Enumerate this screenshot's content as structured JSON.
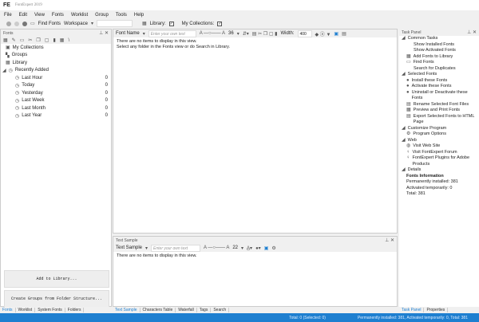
{
  "app": {
    "logo": "FE",
    "title": "FontExpert 2019"
  },
  "menu": [
    "File",
    "Edit",
    "View",
    "Fonts",
    "Worklist",
    "Group",
    "Tools",
    "Help"
  ],
  "toolbar": {
    "find_fonts": "Find Fonts",
    "workspace": "Workspace",
    "library": "Library:",
    "my_collections": "My Collections:"
  },
  "fonts_panel": {
    "title": "Fonts",
    "tree": [
      {
        "label": "My Collections"
      },
      {
        "label": "Groups"
      },
      {
        "label": "Library"
      },
      {
        "label": "Recently Added"
      }
    ],
    "recent": [
      {
        "label": "Last Hour",
        "count": "0"
      },
      {
        "label": "Today",
        "count": "0"
      },
      {
        "label": "Yesterday",
        "count": "0"
      },
      {
        "label": "Last Week",
        "count": "0"
      },
      {
        "label": "Last Month",
        "count": "0"
      },
      {
        "label": "Last Year",
        "count": "0"
      }
    ],
    "add_button": "Add to Library...",
    "create_groups_button": "Create Groups from Folder Structure...",
    "tabs": [
      "Fonts",
      "Worklist",
      "System Fonts",
      "Folders"
    ]
  },
  "font_view": {
    "mode": "Font Name",
    "placeholder": "Enter your own text",
    "size": "36",
    "width_label": "Width:",
    "width": "400",
    "empty1": "There are no items to display in this view.",
    "empty2": "Select any folder in the Fonts view or do Search in Library."
  },
  "text_sample": {
    "title": "Text Sample",
    "mode": "Text Sample",
    "placeholder": "Enter your own text",
    "size": "22",
    "empty": "There are no items to display in this view.",
    "tabs": [
      "Text Sample",
      "Characters Table",
      "Waterfall",
      "Tags",
      "Search"
    ]
  },
  "task_panel": {
    "title": "Task Panel",
    "sections": [
      {
        "title": "Common Tasks",
        "items": [
          "Show Installed Fonts",
          "Show Activated Fonts",
          "Add Fonts to Library",
          "Find Fonts",
          "Search for Duplicates"
        ]
      },
      {
        "title": "Selected Fonts",
        "items": [
          "Install these Fonts",
          "Activate these Fonts",
          "Uninstall or Deactivate these Fonts",
          "Rename Selected Font Files",
          "Preview and Print Fonts",
          "Export Selected Fonts to HTML Page"
        ]
      },
      {
        "title": "Customize Program",
        "items": [
          "Program Options"
        ]
      },
      {
        "title": "Web",
        "items": [
          "Visit Web Site",
          "Visit FontExpert Forum",
          "FontExpert Plugins for Adobe Products"
        ]
      }
    ],
    "details": {
      "title": "Details",
      "heading": "Fonts Information",
      "perm": "Permanently installed: 381",
      "act": "Activated temporarily: 0",
      "total": "Total: 381"
    },
    "tabs": [
      "Task Panel",
      "Properties"
    ]
  },
  "status": {
    "left": "Total: 0 (Selected: 0)",
    "right": "Permanently installed: 381, Activated temporarily: 0, Total: 381"
  },
  "colors": {
    "accent": "#1e7fd0"
  }
}
